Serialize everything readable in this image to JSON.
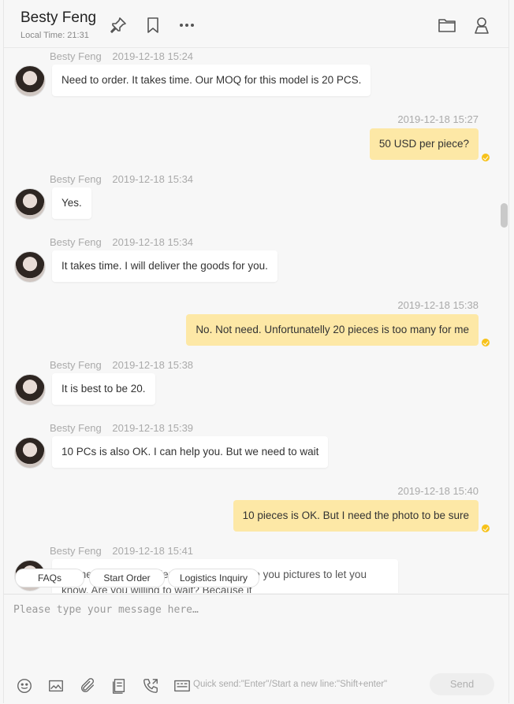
{
  "header": {
    "contact_name": "Besty Feng",
    "local_time": "Local Time: 21:31"
  },
  "messages": [
    {
      "side": "in",
      "sender": "Besty Feng",
      "time": "2019-12-18 15:24",
      "text": "Need to order. It takes time. Our MOQ for this model is 20 PCS."
    },
    {
      "side": "out",
      "time": "2019-12-18 15:27",
      "text": "50 USD per piece?"
    },
    {
      "side": "in",
      "sender": "Besty Feng",
      "time": "2019-12-18 15:34",
      "text": "Yes."
    },
    {
      "side": "in",
      "sender": "Besty Feng",
      "time": "2019-12-18 15:34",
      "text": "It takes time. I will deliver the goods for you."
    },
    {
      "side": "out",
      "time": "2019-12-18 15:38",
      "text": "No. Not need. Unfortunatelly 20 pieces is too many for me"
    },
    {
      "side": "in",
      "sender": "Besty Feng",
      "time": "2019-12-18 15:38",
      "text": "It is best to be 20."
    },
    {
      "side": "in",
      "sender": "Besty Feng",
      "time": "2019-12-18 15:39",
      "text": "10 PCs is also OK. I can help you. But we need to wait"
    },
    {
      "side": "out",
      "time": "2019-12-18 15:40",
      "text": "10 pieces is OK. But I need the photo to be sure"
    },
    {
      "side": "in",
      "sender": "Besty Feng",
      "time": "2019-12-18 15:41",
      "text": "We need to pay the deposit first. I will give you pictures to let you know. Are you willing to wait? Because it"
    }
  ],
  "quick_replies": [
    "FAQs",
    "Start Order",
    "Logistics Inquiry"
  ],
  "composer": {
    "placeholder": "Please type your message here…",
    "hint": "Quick send:\"Enter\"/Start a new line:\"Shift+enter\"",
    "send_label": "Send"
  },
  "colors": {
    "outgoing_bubble": "#fde8a6",
    "read_indicator": "#f7c21a"
  }
}
